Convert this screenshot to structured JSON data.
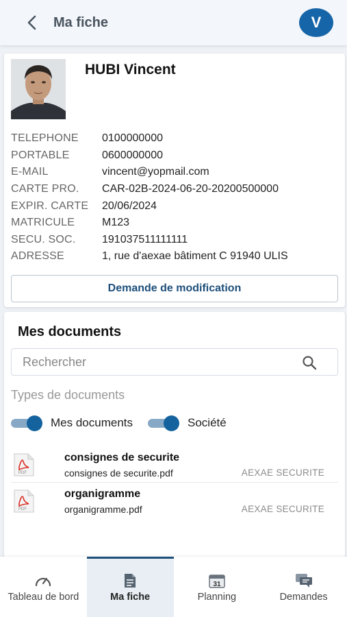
{
  "header": {
    "title": "Ma fiche",
    "back_icon": "chevron-left-icon",
    "avatar_initial": "V"
  },
  "profile": {
    "name": "HUBI Vincent",
    "fields": [
      {
        "label": "TELEPHONE",
        "value": "0100000000"
      },
      {
        "label": "PORTABLE",
        "value": "0600000000"
      },
      {
        "label": "E-MAIL",
        "value": "vincent@yopmail.com"
      },
      {
        "label": "CARTE PRO.",
        "value": "CAR-02B-2024-06-20-20200500000"
      },
      {
        "label": "EXPIR. CARTE",
        "value": "20/06/2024"
      },
      {
        "label": "MATRICULE",
        "value": "M123"
      },
      {
        "label": "SECU. SOC.",
        "value": "191037511111111"
      },
      {
        "label": "ADRESSE",
        "value": "1, rue d'aexae bâtiment C 91940 ULIS"
      }
    ],
    "modify_button": "Demande de modification"
  },
  "documents": {
    "title": "Mes documents",
    "search_placeholder": "Rechercher",
    "types_label": "Types de documents",
    "toggles": [
      {
        "label": "Mes documents",
        "on": true
      },
      {
        "label": "Société",
        "on": true
      }
    ],
    "items": [
      {
        "name": "consignes de securite",
        "file": "consignes de securite.pdf",
        "company": "AEXAE SECURITE",
        "icon": "pdf-icon"
      },
      {
        "name": "organigramme",
        "file": "organigramme.pdf",
        "company": "AEXAE SECURITE",
        "icon": "pdf-icon"
      }
    ]
  },
  "bottom_nav": {
    "items": [
      {
        "label": "Tableau de bord",
        "icon": "gauge-icon",
        "active": false
      },
      {
        "label": "Ma fiche",
        "icon": "document-icon",
        "active": true
      },
      {
        "label": "Planning",
        "icon": "calendar-icon",
        "icon_text": "31",
        "active": false
      },
      {
        "label": "Demandes",
        "icon": "chat-icon",
        "active": false
      }
    ]
  },
  "colors": {
    "accent": "#1565a8",
    "toggle_knob": "#14639e",
    "toggle_track": "#87a9c6",
    "pdf_red": "#d93025"
  }
}
